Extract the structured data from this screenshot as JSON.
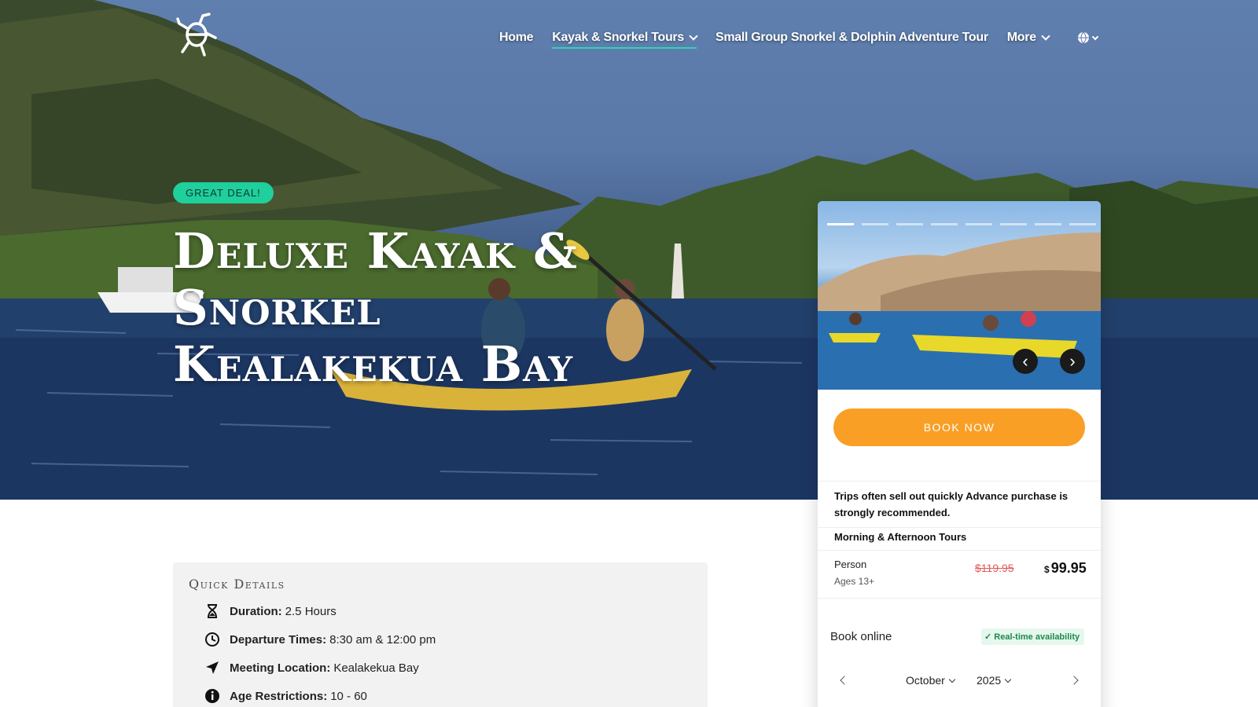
{
  "nav": {
    "items": [
      {
        "label": "Home"
      },
      {
        "label": "Kayak & Snorkel Tours"
      },
      {
        "label": "Small Group Snorkel & Dolphin Adventure Tour"
      },
      {
        "label": "More"
      }
    ],
    "logo_icon": "turtle-icon",
    "language_icon": "globe-icon"
  },
  "hero": {
    "badge": "GREAT DEAL!",
    "title": "Deluxe Kayak & Snorkel Kealakekua Bay"
  },
  "booking": {
    "carousel_slides": 8,
    "carousel_active": 0,
    "book_label": "BOOK NOW",
    "notice": "Trips often sell out quickly Advance purchase is strongly recommended.",
    "tours_heading": "Morning & Afternoon Tours",
    "price": {
      "label": "Person",
      "sub": "Ages 13+",
      "old": "$119.95",
      "currency": "$",
      "new": "99.95"
    },
    "book_online": "Book online",
    "availability": "Real-time availability",
    "month": "October",
    "year": "2025"
  },
  "quick_details": {
    "title": "Quick Details",
    "rows": [
      {
        "label": "Duration:",
        "value": "2.5 Hours",
        "icon": "hourglass-icon"
      },
      {
        "label": "Departure Times:",
        "value": "8:30 am & 12:00 pm",
        "icon": "clock-icon"
      },
      {
        "label": "Meeting Location:",
        "value": "Kealakekua Bay",
        "icon": "location-arrow-icon"
      },
      {
        "label": "Age Restrictions:",
        "value": "10 - 60",
        "icon": "info-icon"
      }
    ]
  },
  "colors": {
    "accent_teal": "#2dd4b4",
    "badge_green": "#1fcf9c",
    "book_orange": "#f99f26",
    "old_price_red": "#e05a5a"
  }
}
